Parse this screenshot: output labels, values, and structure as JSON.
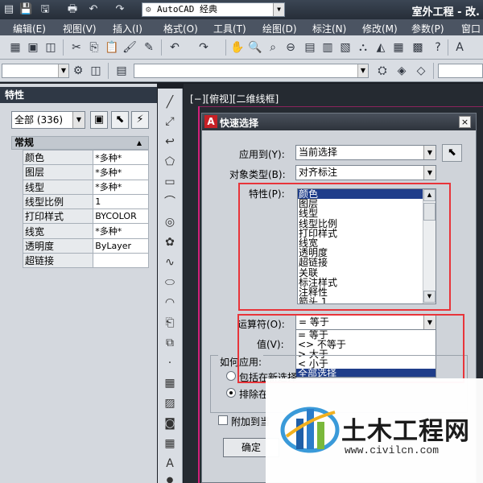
{
  "titlebar": {
    "workspace": "AutoCAD 经典",
    "app_title": "室外工程 - 改."
  },
  "menubar": {
    "items": [
      "编辑(E)",
      "视图(V)",
      "插入(I)",
      "格式(O)",
      "工具(T)",
      "绘图(D)",
      "标注(N)",
      "修改(M)",
      "参数(P)",
      "窗口"
    ]
  },
  "properties_panel": {
    "title": "特性",
    "selection": "全部 (336)",
    "section": "常规",
    "rows": [
      {
        "name": "颜色",
        "value": "*多种*"
      },
      {
        "name": "图层",
        "value": "*多种*"
      },
      {
        "name": "线型",
        "value": "*多种*"
      },
      {
        "name": "线型比例",
        "value": "1"
      },
      {
        "name": "打印样式",
        "value": "BYCOLOR"
      },
      {
        "name": "线宽",
        "value": "*多种*"
      },
      {
        "name": "透明度",
        "value": "ByLayer"
      },
      {
        "name": "超链接",
        "value": ""
      }
    ]
  },
  "canvas": {
    "viewport_label": "[−][俯视][二维线框]",
    "line_color": "#d21f7a"
  },
  "quick_select": {
    "title": "快速选择",
    "logo": "A",
    "close": "×",
    "apply_to_label": "应用到(Y):",
    "apply_to_value": "当前选择",
    "object_type_label": "对象类型(B):",
    "object_type_value": "对齐标注",
    "properties_label": "特性(P):",
    "properties": [
      "颜色",
      "图层",
      "线型",
      "线型比例",
      "打印样式",
      "线宽",
      "透明度",
      "超链接",
      "关联",
      "标注样式",
      "注释性",
      "箭头 1"
    ],
    "operator_label": "运算符(O):",
    "operator_value": "= 等于",
    "operators": [
      "= 等于",
      "<> 不等于",
      "> 大于",
      "< 小于",
      "全部选择"
    ],
    "value_label": "值(V):",
    "howto_label": "如何应用:",
    "include_label": "包括在新选择",
    "exclude_label": "排除在",
    "append_label": "附加到当",
    "ok_label": "确定"
  },
  "watermark": {
    "name": "土木工程网",
    "url": "www.civilcn.com"
  },
  "colors": {
    "highlight_box": "#e8343a",
    "selection_blue": "#1f3d8a"
  }
}
